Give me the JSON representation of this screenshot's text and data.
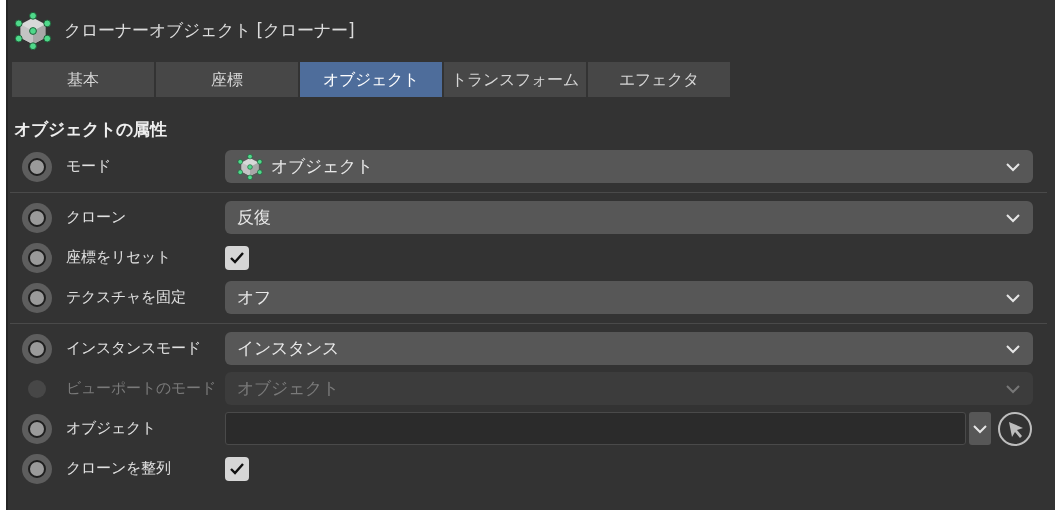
{
  "title": "クローナーオブジェクト [クローナー]",
  "tabs": [
    {
      "label": "基本",
      "selected": false
    },
    {
      "label": "座標",
      "selected": false
    },
    {
      "label": "オブジェクト",
      "selected": true
    },
    {
      "label": "トランスフォーム",
      "selected": false
    },
    {
      "label": "エフェクタ",
      "selected": false
    }
  ],
  "section_title": "オブジェクトの属性",
  "groups": [
    [
      {
        "kind": "dropdown",
        "label": "モード",
        "value": "オブジェクト",
        "has_icon": true,
        "disabled": false
      }
    ],
    [
      {
        "kind": "dropdown",
        "label": "クローン",
        "value": "反復",
        "has_icon": false,
        "disabled": false
      },
      {
        "kind": "checkbox",
        "label": "座標をリセット",
        "checked": true,
        "disabled": false
      },
      {
        "kind": "dropdown",
        "label": "テクスチャを固定",
        "value": "オフ",
        "has_icon": false,
        "disabled": false
      }
    ],
    [
      {
        "kind": "dropdown",
        "label": "インスタンスモード",
        "value": "インスタンス",
        "has_icon": false,
        "disabled": false
      },
      {
        "kind": "dropdown",
        "label": "ビューポートのモード",
        "value": "オブジェクト",
        "has_icon": false,
        "disabled": true
      },
      {
        "kind": "link",
        "label": "オブジェクト",
        "disabled": false
      },
      {
        "kind": "checkbox",
        "label": "クローンを整列",
        "checked": true,
        "disabled": false
      }
    ]
  ]
}
